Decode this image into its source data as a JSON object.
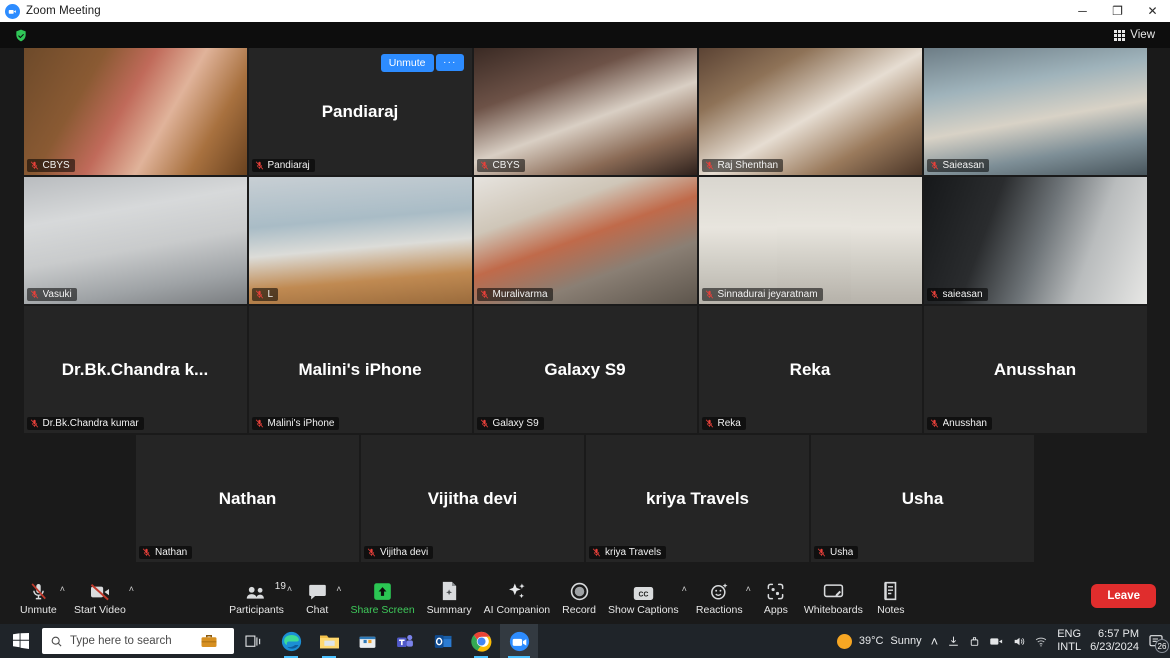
{
  "window": {
    "title": "Zoom Meeting",
    "icon": "zoom-icon",
    "minimize": "─",
    "maximize": "❐",
    "close": "✕"
  },
  "topbar": {
    "security_icon": "shield-check-icon",
    "view_label": "View",
    "view_icon": "grid-icon"
  },
  "gallery": {
    "self_controls": {
      "unmute_label": "Unmute",
      "more_label": "···"
    },
    "rows": [
      [
        {
          "name": "CBYS",
          "display": "",
          "video": true,
          "style": "v-cbys",
          "speaking": true,
          "muted": true
        },
        {
          "name": "Pandiaraj",
          "display": "Pandiaraj",
          "video": false,
          "muted": true,
          "self": true
        },
        {
          "name": "CBYS",
          "display": "",
          "video": true,
          "style": "v-cbys2",
          "muted": true
        },
        {
          "name": "Raj Shenthan",
          "display": "",
          "video": true,
          "style": "v-raj",
          "muted": false
        },
        {
          "name": "Saieasan",
          "display": "",
          "video": true,
          "style": "v-sai",
          "muted": true
        }
      ],
      [
        {
          "name": "Vasuki",
          "display": "",
          "video": true,
          "style": "v-vasuki",
          "muted": true
        },
        {
          "name": "L",
          "display": "",
          "video": true,
          "style": "v-hall",
          "muted": true
        },
        {
          "name": "Muralivarma",
          "display": "",
          "video": true,
          "style": "v-group",
          "muted": true
        },
        {
          "name": "Sinnadurai jeyaratnam",
          "display": "",
          "video": true,
          "style": "v-sinna",
          "inset": true,
          "muted": true
        },
        {
          "name": "saieasan",
          "display": "",
          "video": true,
          "style": "v-dark",
          "muted": true
        }
      ],
      [
        {
          "name": "Dr.Bk.Chandra kumar",
          "display": "Dr.Bk.Chandra  k...",
          "video": false,
          "muted": true
        },
        {
          "name": "Malini's iPhone",
          "display": "Malini's iPhone",
          "video": false,
          "muted": true
        },
        {
          "name": "Galaxy S9",
          "display": "Galaxy S9",
          "video": false,
          "muted": true
        },
        {
          "name": "Reka",
          "display": "Reka",
          "video": false,
          "muted": true
        },
        {
          "name": "Anusshan",
          "display": "Anusshan",
          "video": false,
          "muted": true
        }
      ],
      [
        {
          "name": "Nathan",
          "display": "Nathan",
          "video": false,
          "muted": true
        },
        {
          "name": "Vijitha devi",
          "display": "Vijitha devi",
          "video": false,
          "muted": true
        },
        {
          "name": "kriya Travels",
          "display": "kriya Travels",
          "video": false,
          "muted": true
        },
        {
          "name": "Usha",
          "display": "Usha",
          "video": false,
          "muted": true
        }
      ]
    ]
  },
  "toolbar": {
    "items": [
      {
        "id": "unmute",
        "label": "Unmute",
        "icon": "mic-muted-icon",
        "caret": true
      },
      {
        "id": "start-video",
        "label": "Start Video",
        "icon": "video-muted-icon",
        "caret": true
      },
      {
        "id": "participants",
        "label": "Participants",
        "icon": "participants-icon",
        "caret": true,
        "count": "19"
      },
      {
        "id": "chat",
        "label": "Chat",
        "icon": "chat-icon",
        "caret": true
      },
      {
        "id": "share-screen",
        "label": "Share Screen",
        "icon": "share-screen-icon",
        "caret": false,
        "green": true
      },
      {
        "id": "summary",
        "label": "Summary",
        "icon": "summary-icon",
        "caret": false
      },
      {
        "id": "ai-companion",
        "label": "AI Companion",
        "icon": "sparkle-icon",
        "caret": false
      },
      {
        "id": "record",
        "label": "Record",
        "icon": "record-icon",
        "caret": false
      },
      {
        "id": "show-captions",
        "label": "Show Captions",
        "icon": "cc-icon",
        "caret": true
      },
      {
        "id": "reactions",
        "label": "Reactions",
        "icon": "reactions-icon",
        "caret": true
      },
      {
        "id": "apps",
        "label": "Apps",
        "icon": "apps-icon",
        "caret": false
      },
      {
        "id": "whiteboards",
        "label": "Whiteboards",
        "icon": "whiteboard-icon",
        "caret": false
      },
      {
        "id": "notes",
        "label": "Notes",
        "icon": "notes-icon",
        "caret": false
      }
    ],
    "leave_label": "Leave"
  },
  "taskbar": {
    "start_icon": "windows-start-icon",
    "search_placeholder": "Type here to search",
    "search_icon": "search-icon",
    "apps": [
      {
        "id": "task-view",
        "icon": "task-view-icon"
      },
      {
        "id": "edge",
        "icon": "edge-icon"
      },
      {
        "id": "file-explorer",
        "icon": "folder-icon"
      },
      {
        "id": "store",
        "icon": "microsoft-store-icon"
      },
      {
        "id": "teams",
        "icon": "teams-icon"
      },
      {
        "id": "outlook",
        "icon": "outlook-icon"
      },
      {
        "id": "chrome",
        "icon": "chrome-icon"
      },
      {
        "id": "zoom",
        "icon": "zoom-icon"
      }
    ],
    "weather": {
      "temperature": "39°C",
      "condition": "Sunny",
      "icon": "sun-icon"
    },
    "tray": {
      "chevron": "˄",
      "icons": [
        "onedrive-icon",
        "safely-remove-icon",
        "webcam-icon",
        "volume-icon",
        "wifi-icon"
      ],
      "language": "ENG",
      "keyboard": "INTL",
      "time": "6:57 PM",
      "date": "6/23/2024",
      "notification_count": "26"
    }
  }
}
